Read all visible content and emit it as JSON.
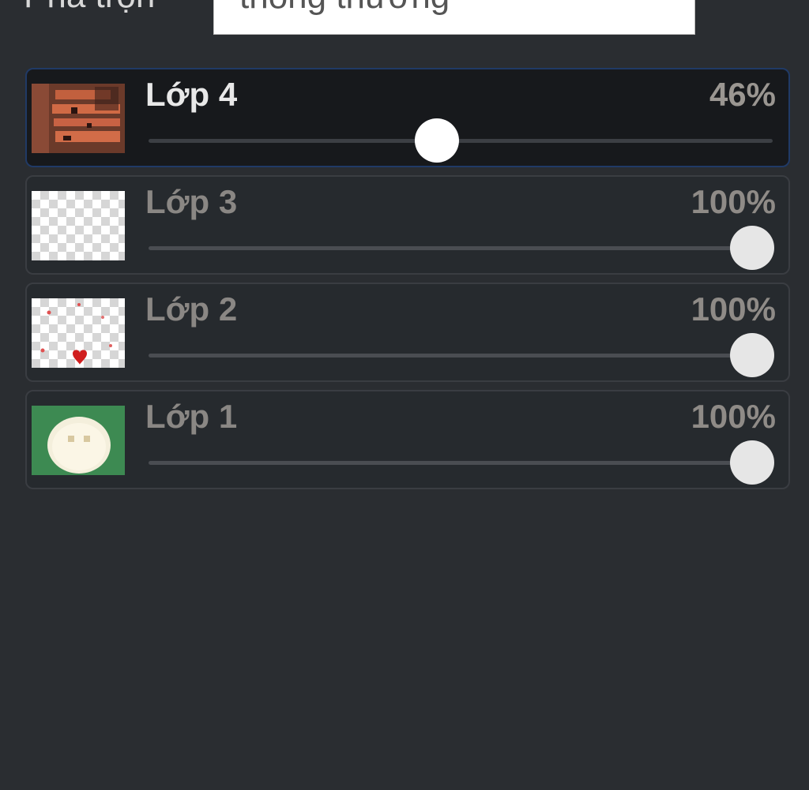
{
  "blend": {
    "label": "Pha trộn",
    "value": "thông thường"
  },
  "layers": [
    {
      "name": "Lớp 4",
      "opacity_label": "46%",
      "opacity": 0.46,
      "active": true
    },
    {
      "name": "Lớp 3",
      "opacity_label": "100%",
      "opacity": 1.0,
      "active": false
    },
    {
      "name": "Lớp 2",
      "opacity_label": "100%",
      "opacity": 1.0,
      "active": false
    },
    {
      "name": "Lớp 1",
      "opacity_label": "100%",
      "opacity": 1.0,
      "active": false
    }
  ],
  "colors": {
    "panel_bg": "#2a2d31",
    "active_border": "#203a66",
    "thumb_green": "#3d8a52"
  }
}
